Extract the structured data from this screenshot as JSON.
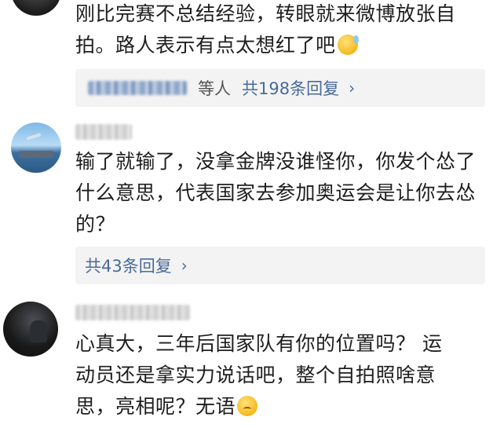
{
  "comments": [
    {
      "text_lines": [
        "刚比完赛不总结经验，转眼就来微博放张自",
        "拍。路人表示有点太想红了吧"
      ],
      "emoji": "grinning-sweat-emoji",
      "replies": {
        "suffix": "等人",
        "count_text": "共198条回复",
        "chevron": "›"
      }
    },
    {
      "text_lines": [
        "输了就输了，没拿金牌没谁怪你，你发个怂了",
        "什么意思，代表国家去参加奥运会是让你去怂",
        "的？"
      ],
      "replies": {
        "count_text": "共43条回复",
        "chevron": "›"
      }
    },
    {
      "text_lines": [
        "心真大，三年后国家队有你的位置吗？ 运",
        "动员还是拿实力说话吧，整个自拍照啥意",
        "思，亮相呢？无语"
      ],
      "emoji": "frowning-emoji"
    }
  ]
}
